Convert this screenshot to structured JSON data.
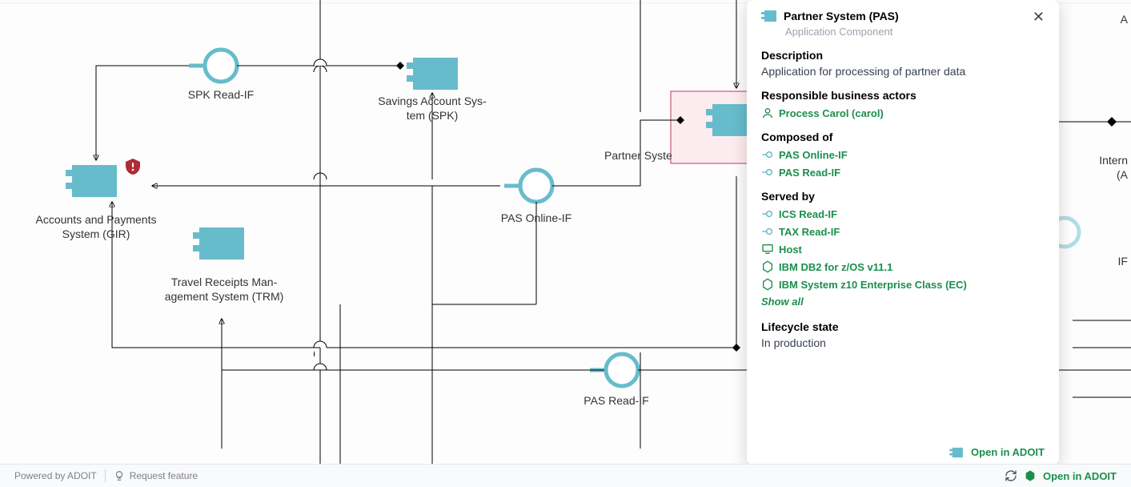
{
  "diagram": {
    "nodes": {
      "spk_read_if": "SPK Read-IF",
      "savings_account": "Savings Account Sys-\ntem (SPK)",
      "accounts_payments": "Accounts and Payments\nSystem (GIR)",
      "travel_receipts": "Travel Receipts Man-\nagement System (TRM)",
      "pas_online_if": "PAS Online-IF",
      "partner_system": "Partner Syste",
      "pas_read_if": "PAS Read-IF",
      "intern": "Intern",
      "intern2": "(A",
      "apl": "A",
      "if_label": "IF"
    }
  },
  "panel": {
    "title": "Partner System (PAS)",
    "subtitle": "Application Component",
    "description_label": "Description",
    "description": "Application for processing of partner data",
    "actors_label": "Responsible business actors",
    "actor": "Process Carol (carol)",
    "composed_label": "Composed of",
    "composed": [
      "PAS Online-IF",
      "PAS Read-IF"
    ],
    "served_label": "Served by",
    "served": [
      "ICS Read-IF",
      "TAX Read-IF",
      "Host",
      "IBM DB2 for z/OS v11.1",
      "IBM System z10 Enterprise Class (EC)"
    ],
    "show_all": "Show all",
    "lifecycle_label": "Lifecycle state",
    "lifecycle": "In production",
    "open_in": "Open in ADOIT"
  },
  "footer": {
    "powered": "Powered by ADOIT",
    "request_feature": "Request feature",
    "open_in": "Open in ADOIT"
  }
}
